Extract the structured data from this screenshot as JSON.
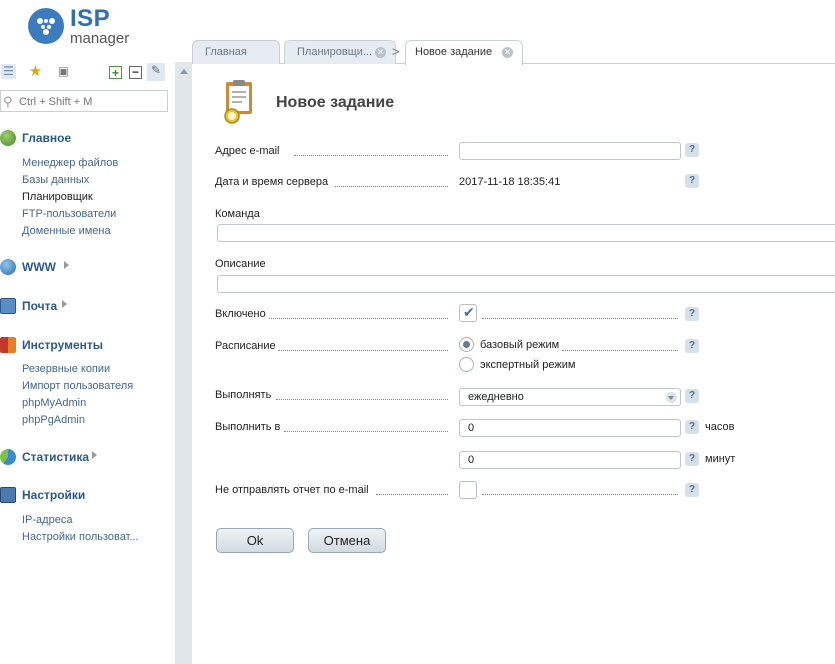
{
  "brand": {
    "logo_isp": "ISP",
    "logo_manager": "manager"
  },
  "tabs": [
    {
      "label": "Главная"
    },
    {
      "label": "Планировщи..."
    },
    {
      "label": "Новое задание"
    }
  ],
  "sidebar": {
    "search_placeholder": "Ctrl + Shift + M",
    "sections": {
      "main": {
        "label": "Главное",
        "items": [
          "Менеджер файлов",
          "Базы данных",
          "Планировщик",
          "FTP-пользователи",
          "Доменные имена"
        ]
      },
      "www": {
        "label": "WWW"
      },
      "mail": {
        "label": "Почта"
      },
      "tools": {
        "label": "Инструменты",
        "items": [
          "Резервные копии",
          "Импорт пользователя",
          "phpMyAdmin",
          "phpPgAdmin"
        ]
      },
      "stats": {
        "label": "Статистика"
      },
      "settings": {
        "label": "Настройки",
        "items": [
          "IP-адреса",
          "Настройки пользоват..."
        ]
      }
    }
  },
  "form": {
    "title": "Новое задание",
    "email_label": "Адрес e-mail",
    "email_value": "",
    "server_time_label": "Дата и время сервера",
    "server_time_value": "2017-11-18 18:35:41",
    "command_label": "Команда",
    "command_value": "",
    "description_label": "Описание",
    "description_value": "",
    "enabled_label": "Включено",
    "enabled": true,
    "schedule_label": "Расписание",
    "schedule_options": [
      "базовый режим",
      "экспертный режим"
    ],
    "schedule_selected": "базовый режим",
    "run_label": "Выполнять",
    "run_value": "ежедневно",
    "run_at_label": "Выполнить в",
    "hours_value": "0",
    "hours_unit": "часов",
    "minutes_value": "0",
    "minutes_unit": "минут",
    "no_report_label": "Не отправлять отчет по e-mail",
    "no_report": false,
    "help_glyph": "?",
    "ok_label": "Ok",
    "cancel_label": "Отмена"
  },
  "colors": {
    "accent": "#2e6fb5",
    "link": "#46678a",
    "sidebar_bg": "#e1e6eb"
  }
}
